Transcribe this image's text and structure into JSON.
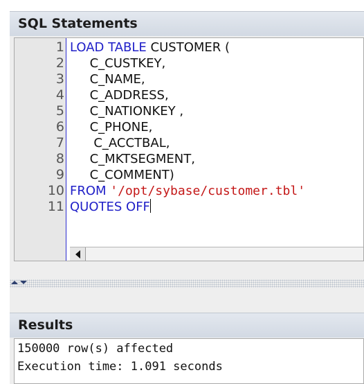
{
  "sql_panel": {
    "title": "SQL Statements"
  },
  "editor": {
    "lines": [
      {
        "num": "1",
        "segments": [
          {
            "t": "LOAD TABLE ",
            "c": "kw"
          },
          {
            "t": "CUSTOMER (",
            "c": "tx"
          }
        ]
      },
      {
        "num": "2",
        "segments": [
          {
            "t": "     C_CUSTKEY,",
            "c": "tx"
          }
        ]
      },
      {
        "num": "3",
        "segments": [
          {
            "t": "     C_NAME,",
            "c": "tx"
          }
        ]
      },
      {
        "num": "4",
        "segments": [
          {
            "t": "     C_ADDRESS,",
            "c": "tx"
          }
        ]
      },
      {
        "num": "5",
        "segments": [
          {
            "t": "     C_NATIONKEY ,",
            "c": "tx"
          }
        ]
      },
      {
        "num": "6",
        "segments": [
          {
            "t": "     C_PHONE,",
            "c": "tx"
          }
        ]
      },
      {
        "num": "7",
        "segments": [
          {
            "t": "      C_ACCTBAL,",
            "c": "tx"
          }
        ]
      },
      {
        "num": "8",
        "segments": [
          {
            "t": "     C_MKTSEGMENT,",
            "c": "tx"
          }
        ]
      },
      {
        "num": "9",
        "segments": [
          {
            "t": "     C_COMMENT)",
            "c": "tx"
          }
        ]
      },
      {
        "num": "10",
        "segments": [
          {
            "t": "FROM ",
            "c": "kw"
          },
          {
            "t": "'/opt/sybase/customer.tbl'",
            "c": "str"
          }
        ]
      },
      {
        "num": "11",
        "segments": [
          {
            "t": "QUOTES OFF",
            "c": "kw"
          }
        ]
      }
    ]
  },
  "results_panel": {
    "title": "Results",
    "output": [
      "150000 row(s) affected",
      "Execution time: 1.091 seconds"
    ]
  },
  "colors": {
    "keyword": "#2020c8",
    "string": "#c41818",
    "gutter": "#e7e7e7"
  }
}
